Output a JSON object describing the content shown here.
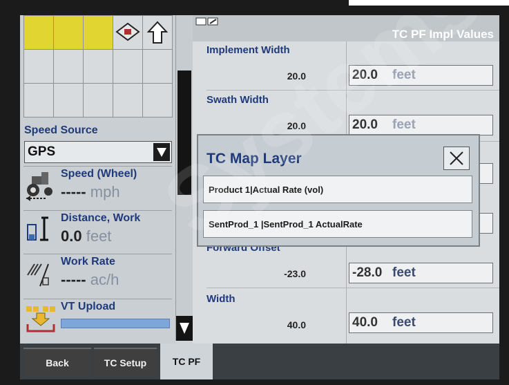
{
  "header": {
    "title": "TC PF Impl Values"
  },
  "left": {
    "speed_source_label": "Speed Source",
    "speed_source_value": "GPS",
    "speed": {
      "label": "Speed (Wheel)",
      "value": "-----",
      "unit": "mph"
    },
    "distance": {
      "label": "Distance, Work",
      "value": "0.0",
      "unit": "feet"
    },
    "work_rate": {
      "label": "Work Rate",
      "value": "-----",
      "unit": "ac/h"
    },
    "vt_upload": {
      "label": "VT Upload",
      "progress": 1.0
    }
  },
  "fields": [
    {
      "label": "Implement Width",
      "number": "20.0",
      "value": "20.0",
      "unit": "feet"
    },
    {
      "label": "Swath Width",
      "number": "20.0",
      "value": "20.0",
      "unit": "feet"
    },
    {
      "label": "Forward Offset",
      "number": "-23.0",
      "value": "-28.0",
      "unit": "feet"
    },
    {
      "label": "Width",
      "number": "40.0",
      "value": "40.0",
      "unit": "feet"
    }
  ],
  "popup": {
    "title": "TC Map Layer",
    "options": [
      "Product 1|Actual Rate (vol)",
      "SentProd_1 |SentProd_1 ActualRate"
    ]
  },
  "tabs": [
    "Back",
    "TC Setup",
    "TC PF"
  ],
  "watermark": "Systems",
  "colors": {
    "accent": "#1f3a7a",
    "grid_yellow": "#e1d531",
    "progress": "#7fa6d9"
  }
}
